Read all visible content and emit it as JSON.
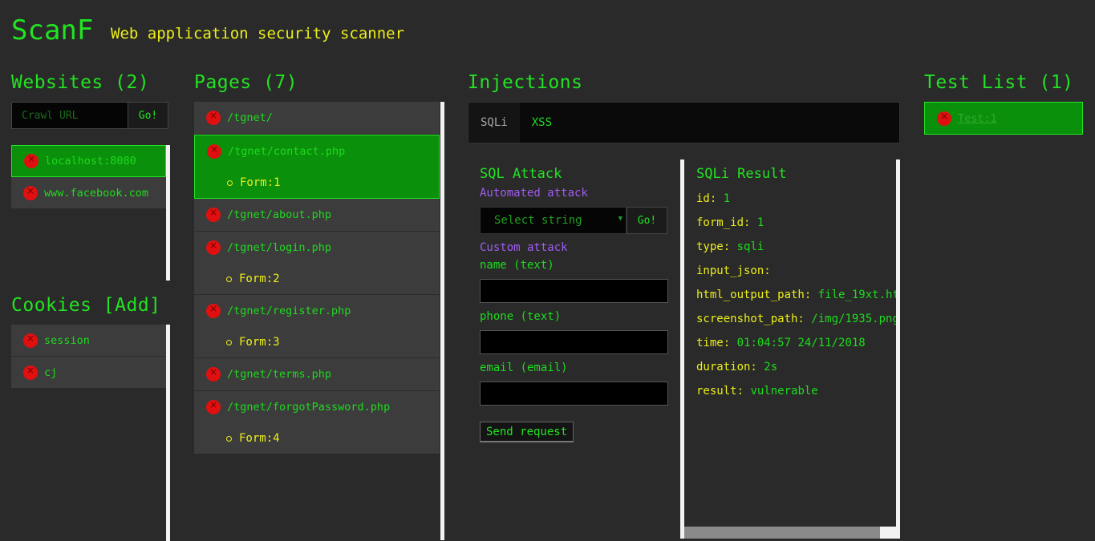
{
  "header": {
    "brand": "ScanF",
    "tagline": "Web application security scanner"
  },
  "websites": {
    "title": "Websites (2)",
    "crawl_placeholder": "Crawl URL",
    "go_label": "Go!",
    "items": [
      {
        "label": "localhost:8080",
        "active": true
      },
      {
        "label": "www.facebook.com",
        "active": false
      }
    ]
  },
  "cookies": {
    "title": "Cookies [Add]",
    "items": [
      {
        "label": "session"
      },
      {
        "label": "cj"
      }
    ]
  },
  "pages": {
    "title": "Pages (7)",
    "items": [
      {
        "label": "/tgnet/",
        "forms": []
      },
      {
        "label": "/tgnet/contact.php",
        "forms": [
          "Form:1"
        ],
        "active": true
      },
      {
        "label": "/tgnet/about.php",
        "forms": []
      },
      {
        "label": "/tgnet/login.php",
        "forms": [
          "Form:2"
        ]
      },
      {
        "label": "/tgnet/register.php",
        "forms": [
          "Form:3"
        ]
      },
      {
        "label": "/tgnet/terms.php",
        "forms": []
      },
      {
        "label": "/tgnet/forgotPassword.php",
        "forms": [
          "Form:4"
        ]
      }
    ]
  },
  "injections": {
    "title": "Injections",
    "tabs": [
      {
        "label": "SQLi",
        "active": true
      },
      {
        "label": "XSS",
        "active": false
      }
    ],
    "attack": {
      "title": "SQL Attack",
      "automated_label": "Automated attack",
      "select_placeholder": "Select string",
      "go_label": "Go!",
      "custom_label": "Custom attack",
      "fields": [
        {
          "label": "name (text)",
          "value": ""
        },
        {
          "label": "phone (text)",
          "value": ""
        },
        {
          "label": "email (email)",
          "value": ""
        }
      ],
      "send_label": "Send request"
    },
    "result": {
      "title": "SQLi Result",
      "rows": [
        {
          "key": "id:",
          "value": "1"
        },
        {
          "key": "form_id:",
          "value": "1"
        },
        {
          "key": "type:",
          "value": "sqli"
        },
        {
          "key": "input_json:",
          "value": ""
        },
        {
          "key": "html_output_path:",
          "value": "file_19xt.ht"
        },
        {
          "key": "screenshot_path:",
          "value": "/img/1935.png"
        },
        {
          "key": "time:",
          "value": "01:04:57 24/11/2018"
        },
        {
          "key": "duration:",
          "value": "2s"
        },
        {
          "key": "result:",
          "value": "vulnerable"
        }
      ]
    }
  },
  "tests": {
    "title": "Test List (1)",
    "items": [
      {
        "label": "Test:1"
      }
    ]
  },
  "colors": {
    "background": "#2a2a2a",
    "accent": "#22e322",
    "active_bg": "#0a900a",
    "key": "#ecef1a",
    "section": "#a25cf2",
    "delete": "#e01010"
  }
}
